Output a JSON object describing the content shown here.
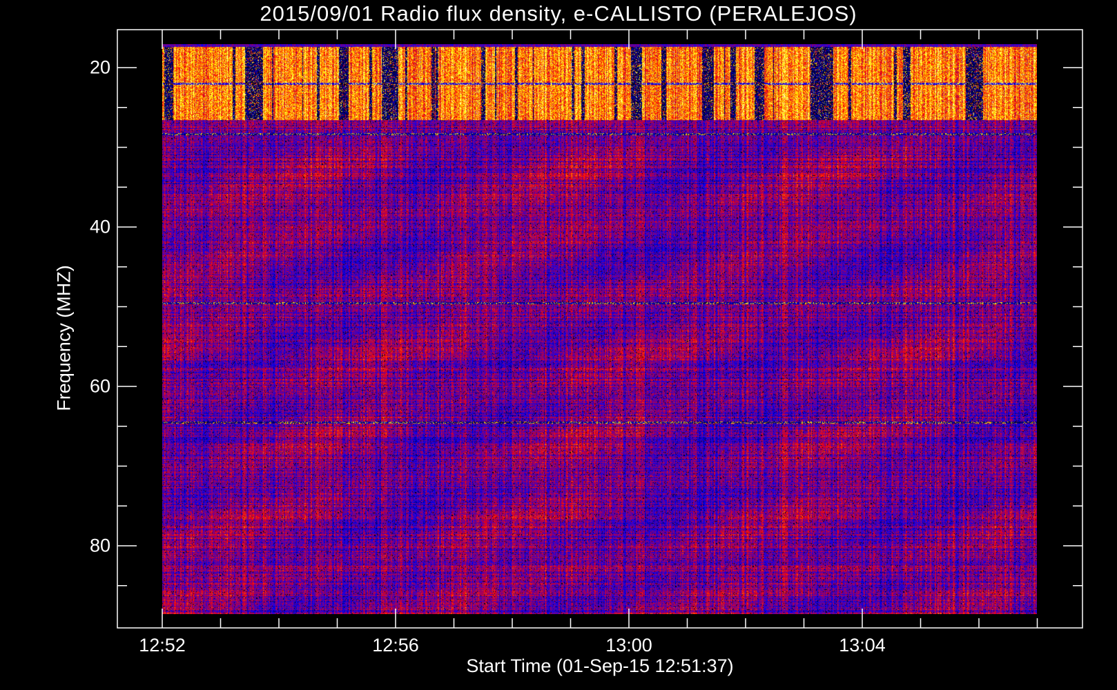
{
  "chart_data": {
    "type": "heatmap",
    "title": "2015/09/01  Radio flux density, e-CALLISTO (PERALEJOS)",
    "xlabel": "Start Time (01-Sep-15 12:51:37)",
    "ylabel": "Frequency (MHZ)",
    "x_ticks": [
      "12:52",
      "12:56",
      "13:00",
      "13:04"
    ],
    "x_tick_minutes": [
      0,
      4,
      8,
      12
    ],
    "x_minor_tick_step_min": 1,
    "x_data_range_min": [
      0,
      15
    ],
    "xlim_min": [
      -0.75,
      15.75
    ],
    "y_ticks": [
      "20",
      "40",
      "60",
      "80"
    ],
    "y_tick_values": [
      20,
      40,
      60,
      80
    ],
    "y_minor_tick_step": 5,
    "y_data_range": [
      17,
      88.6
    ],
    "ylim": [
      15.2,
      90.5
    ],
    "y_inverted": true,
    "colormap": [
      "#000000",
      "#0000ff",
      "#ff0000",
      "#ffff00",
      "#ffffff"
    ],
    "features": {
      "strong_band_mhz": [
        17,
        26.5
      ],
      "interference_line_mhz": [
        22,
        28.3,
        49.5,
        64.5
      ]
    },
    "grid": false
  }
}
